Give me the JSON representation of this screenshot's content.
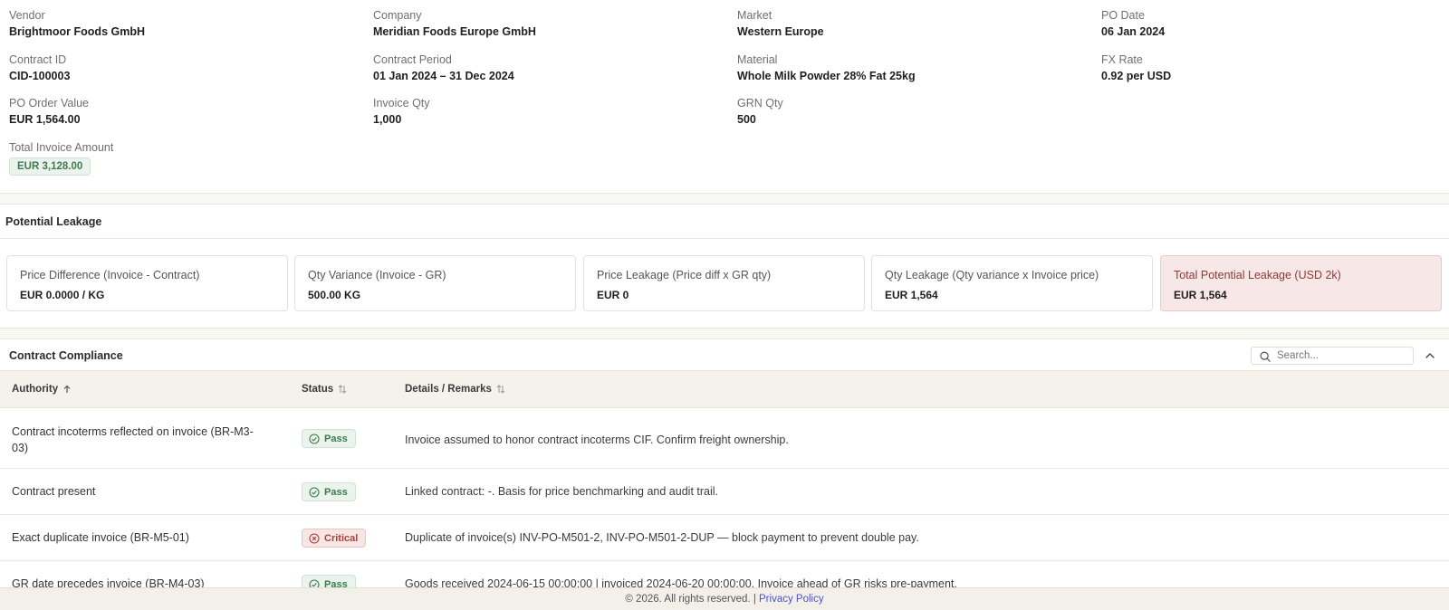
{
  "details": {
    "vendor": {
      "label": "Vendor",
      "value": "Brightmoor Foods GmbH"
    },
    "company": {
      "label": "Company",
      "value": "Meridian Foods Europe GmbH"
    },
    "market": {
      "label": "Market",
      "value": "Western Europe"
    },
    "po_date": {
      "label": "PO Date",
      "value": "06 Jan 2024"
    },
    "contract_id": {
      "label": "Contract ID",
      "value": "CID-100003"
    },
    "contract_period": {
      "label": "Contract Period",
      "value": "01 Jan 2024 – 31 Dec 2024"
    },
    "material": {
      "label": "Material",
      "value": "Whole Milk Powder 28% Fat 25kg"
    },
    "fx_rate": {
      "label": "FX Rate",
      "value": "0.92 per USD"
    },
    "po_order_value": {
      "label": "PO Order Value",
      "value": "EUR 1,564.00"
    },
    "invoice_qty": {
      "label": "Invoice Qty",
      "value": "1,000"
    },
    "grn_qty": {
      "label": "GRN Qty",
      "value": "500"
    },
    "total_invoice_amount": {
      "label": "Total Invoice Amount",
      "value": "EUR 3,128.00"
    }
  },
  "leakage": {
    "title": "Potential Leakage",
    "cards": [
      {
        "label": "Price Difference (Invoice - Contract)",
        "value": "EUR 0.0000 / KG"
      },
      {
        "label": "Qty Variance (Invoice - GR)",
        "value": "500.00 KG"
      },
      {
        "label": "Price Leakage (Price diff x GR qty)",
        "value": "EUR 0"
      },
      {
        "label": "Qty Leakage (Qty variance x Invoice price)",
        "value": "EUR 1,564"
      },
      {
        "label": "Total Potential Leakage (USD 2k)",
        "value": "EUR 1,564"
      }
    ]
  },
  "compliance": {
    "title": "Contract Compliance",
    "search_placeholder": "Search...",
    "columns": {
      "authority": "Authority",
      "status": "Status",
      "details": "Details / Remarks"
    },
    "rows": [
      {
        "authority": "Contract incoterms reflected on invoice (BR-M3-03)",
        "status": "Pass",
        "details": "Invoice assumed to honor contract incoterms CIF. Confirm freight ownership."
      },
      {
        "authority": "Contract present",
        "status": "Pass",
        "details": "Linked contract: -. Basis for price benchmarking and audit trail."
      },
      {
        "authority": "Exact duplicate invoice (BR-M5-01)",
        "status": "Critical",
        "details": "Duplicate of invoice(s) INV-PO-M501-2, INV-PO-M501-2-DUP — block payment to prevent double pay."
      },
      {
        "authority": "GR date precedes invoice (BR-M4-03)",
        "status": "Pass",
        "details": "Goods received 2024-06-15 00:00:00 | invoiced 2024-06-20 00:00:00. Invoice ahead of GR risks pre-payment."
      }
    ]
  },
  "footer": {
    "copyright": "© 2026. All rights reserved. |",
    "privacy_link": "Privacy Policy"
  },
  "colors": {
    "pass": "#3f7a4e",
    "critical": "#a8433c",
    "link": "#4a53c8",
    "total_leak_bg": "#f7e7e6"
  }
}
